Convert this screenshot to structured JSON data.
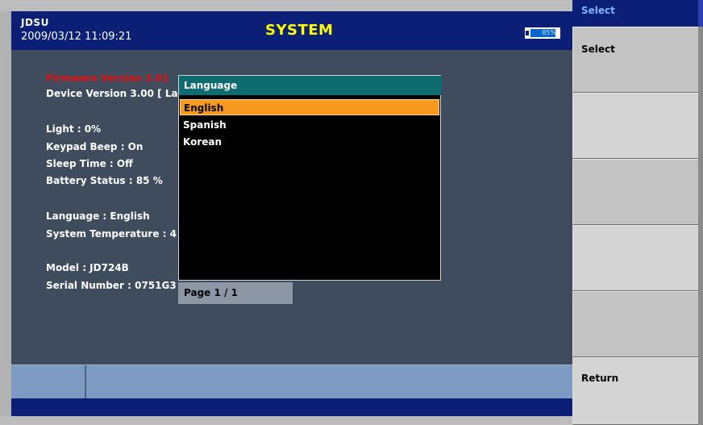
{
  "header": {
    "brand": "JDSU",
    "datetime": "2009/03/12 11:09:21",
    "title": "SYSTEM",
    "battery_percent": "85%",
    "battery_level": 0.85
  },
  "info": {
    "firmware": "Firmware Version 3.01",
    "device": "Device Version 3.00 [ La",
    "light": "Light : 0%",
    "keypad_beep": "Keypad Beep : On",
    "sleep_time": "Sleep Time : Off",
    "battery_status": "Battery Status : 85 %",
    "language": "Language : English",
    "system_temperature": "System Temperature : 4",
    "model": "Model : JD724B",
    "serial_number": "Serial Number : 0751G3"
  },
  "language_popup": {
    "title": "Language",
    "items": [
      "English",
      "Spanish",
      "Korean"
    ],
    "selected": "English",
    "page": "Page  1 /  1"
  },
  "softkeys": {
    "header": "Select",
    "keys": [
      "Select",
      "",
      "",
      "",
      "",
      "Return"
    ]
  },
  "colors": {
    "header_bg": "#0c1f77",
    "title": "#ffff00",
    "selection": "#f7991f",
    "popup_title_bg": "#0e6b6f",
    "main_bg": "#3f4c5e",
    "firmware_text": "#e01010"
  }
}
